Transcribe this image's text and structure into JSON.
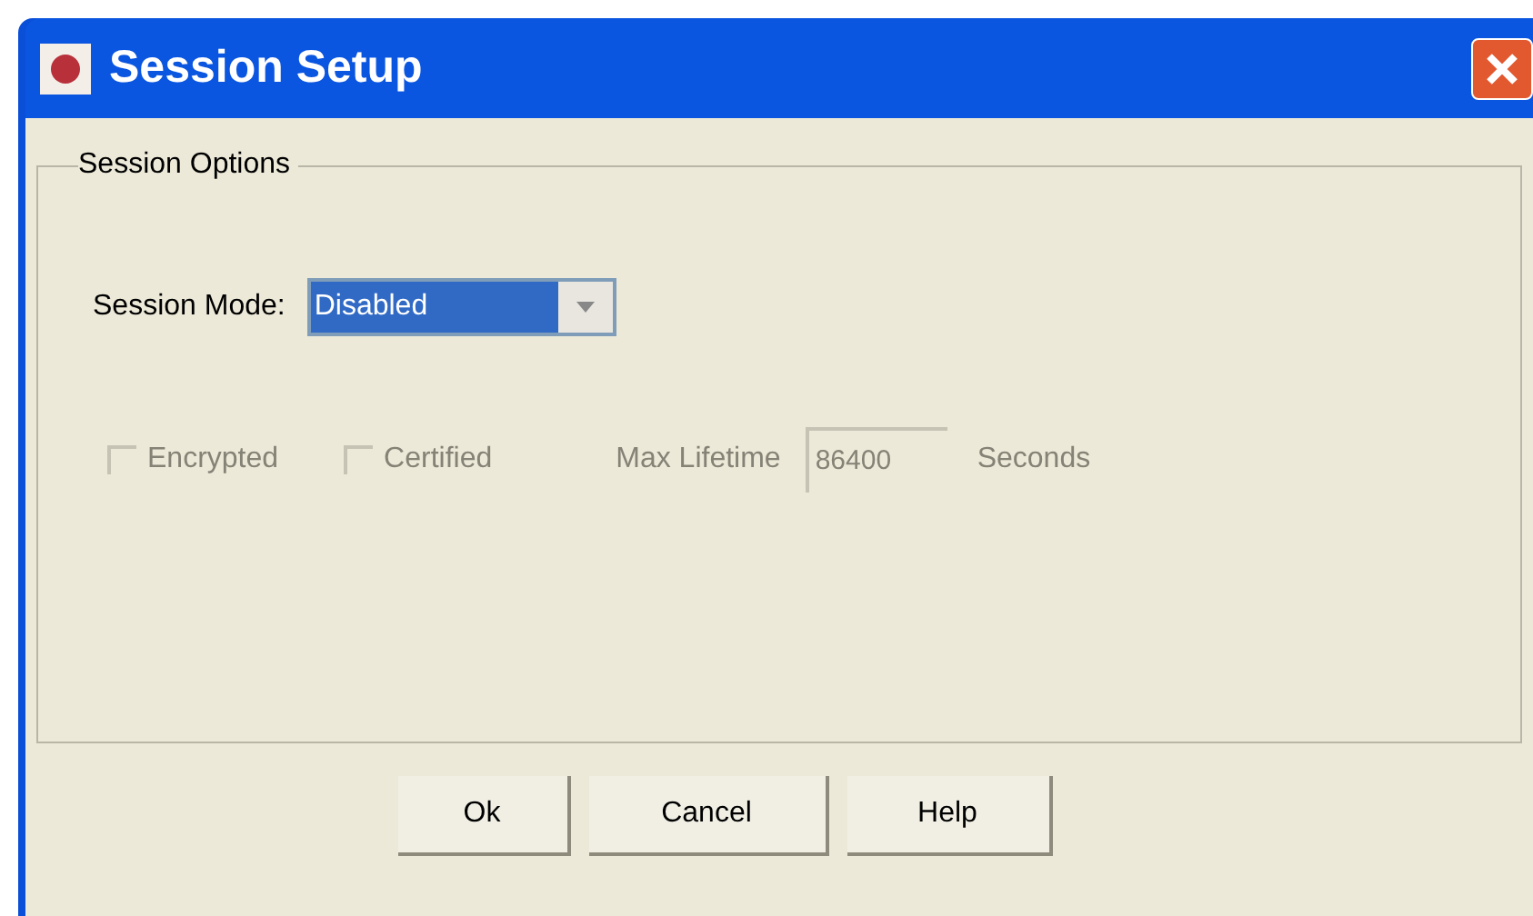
{
  "window": {
    "title": "Session Setup"
  },
  "group": {
    "title": "Session Options"
  },
  "session_mode": {
    "label": "Session Mode:",
    "value": "Disabled"
  },
  "options": [
    {
      "kind": "checkbox",
      "label": "Encrypted",
      "checked": false,
      "disabled": true
    },
    {
      "kind": "checkbox",
      "label": "Certified",
      "checked": false,
      "disabled": true
    }
  ],
  "lifetime": {
    "label": "Max Lifetime",
    "value": "86400",
    "unit": "Seconds",
    "disabled": true
  },
  "buttons": [
    "Ok",
    "Cancel",
    "Help"
  ]
}
